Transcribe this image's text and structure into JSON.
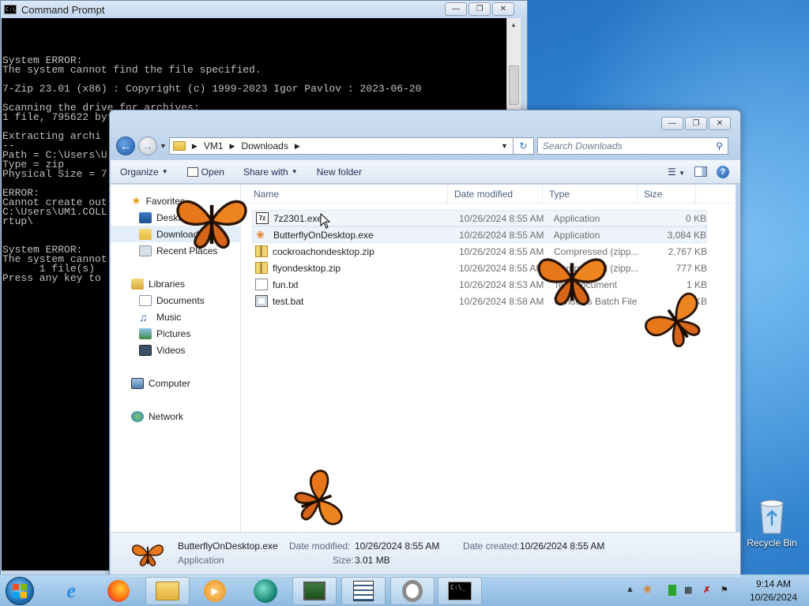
{
  "cmd": {
    "title": "Command Prompt",
    "lines": "\nSystem ERROR:\nThe system cannot find the file specified.\n\n7-Zip 23.01 (x86) : Copyright (c) 1999-2023 Igor Pavlov : 2023-06-20\n\nScanning the drive for archives:\n1 file, 795622 bytes (777 KiB)\n\nExtracting archi\n--\nPath = C:\\Users\\U\nType = zip\nPhysical Size = 7\n\nERROR:\nCannot create out\nC:\\Users\\UM1.COLL\nrtup\\\n\n\nSystem ERROR:\nThe system cannot\n      1 file(s)\nPress any key to"
  },
  "explorer": {
    "breadcrumb": [
      "VM1",
      "Downloads"
    ],
    "search_placeholder": "Search Downloads",
    "toolbar": {
      "organize": "Organize",
      "open": "Open",
      "share": "Share with",
      "new_folder": "New folder"
    },
    "nav": {
      "favorites": "Favorites",
      "desktop": "Desktop",
      "downloads": "Downloads",
      "recent": "Recent Places",
      "libraries": "Libraries",
      "documents": "Documents",
      "music": "Music",
      "pictures": "Pictures",
      "videos": "Videos",
      "computer": "Computer",
      "network": "Network"
    },
    "columns": {
      "name": "Name",
      "date": "Date modified",
      "type": "Type",
      "size": "Size"
    },
    "files": [
      {
        "name": "7z2301.exe",
        "date": "10/26/2024 8:55 AM",
        "type": "Application",
        "size": "0 KB",
        "icon": "7zip-icon"
      },
      {
        "name": "ButterflyOnDesktop.exe",
        "date": "10/26/2024 8:55 AM",
        "type": "Application",
        "size": "3,084 KB",
        "icon": "butterfly-icon"
      },
      {
        "name": "cockroachondesktop.zip",
        "date": "10/26/2024 8:55 AM",
        "type": "Compressed (zipp...",
        "size": "2,767 KB",
        "icon": "zip-icon"
      },
      {
        "name": "flyondesktop.zip",
        "date": "10/26/2024 8:55 AM",
        "type": "Compressed (zipp...",
        "size": "777 KB",
        "icon": "zip-icon"
      },
      {
        "name": "fun.txt",
        "date": "10/26/2024 8:53 AM",
        "type": "Text Document",
        "size": "1 KB",
        "icon": "text-file-icon"
      },
      {
        "name": "test.bat",
        "date": "10/26/2024 8:58 AM",
        "type": "Windows Batch File",
        "size": "1 KB",
        "icon": "batch-file-icon"
      }
    ],
    "details": {
      "name": "ButterflyOnDesktop.exe",
      "type": "Application",
      "modified_label": "Date modified:",
      "modified": "10/26/2024 8:55 AM",
      "created_label": "Date created:",
      "created": "10/26/2024 8:55 AM",
      "size_label": "Size:",
      "size": "3.01 MB"
    }
  },
  "desktop": {
    "recycle_bin": "Recycle Bin"
  },
  "taskbar": {
    "time": "9:14 AM",
    "date": "10/26/2024"
  }
}
